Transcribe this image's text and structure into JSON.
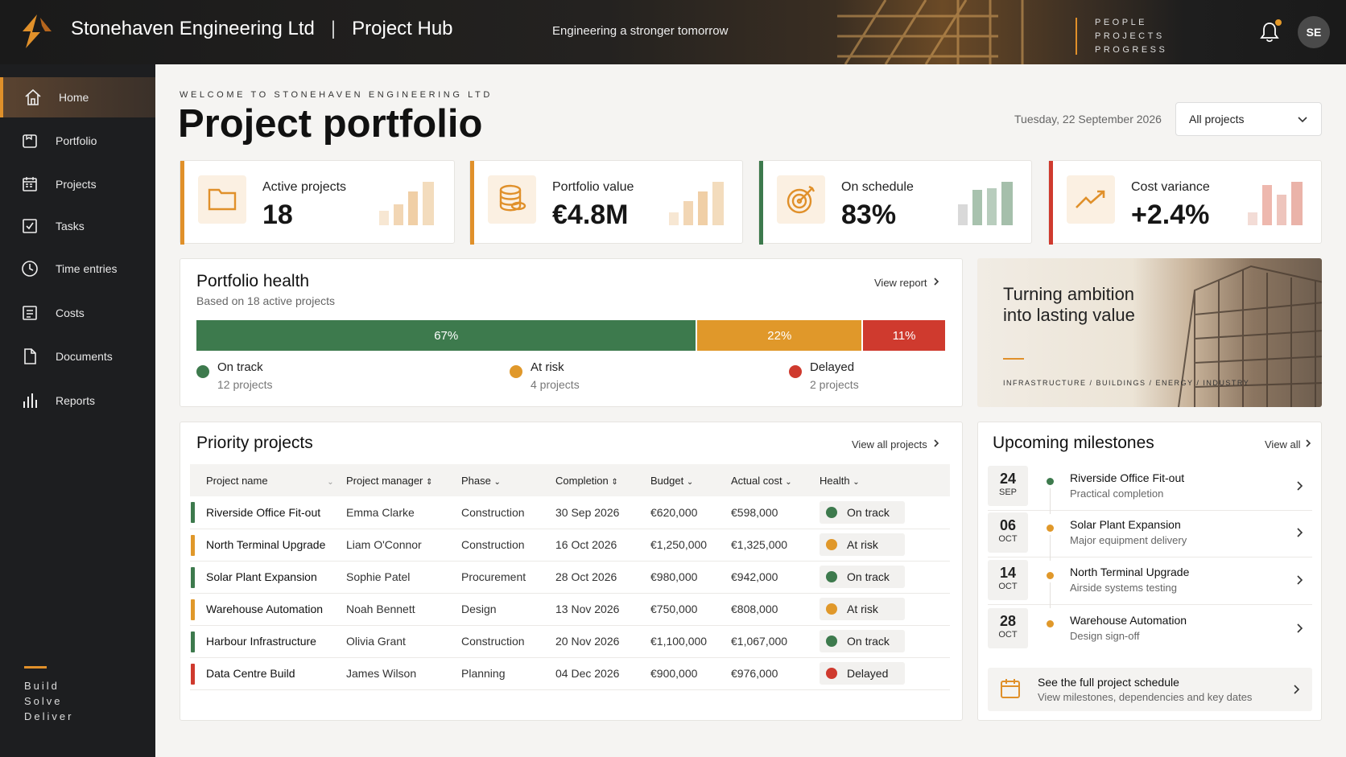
{
  "header": {
    "company": "Stonehaven Engineering Ltd",
    "app": "Project Hub",
    "tagline": "Engineering a stronger tomorrow",
    "motto": [
      "PEOPLE",
      "PROJECTS",
      "PROGRESS"
    ],
    "avatar_initials": "SE"
  },
  "sidebar": {
    "items": [
      {
        "label": "Home",
        "icon": "home-icon"
      },
      {
        "label": "Portfolio",
        "icon": "briefcase-icon"
      },
      {
        "label": "Projects",
        "icon": "calendar-icon"
      },
      {
        "label": "Tasks",
        "icon": "checkbox-icon"
      },
      {
        "label": "Time entries",
        "icon": "clock-icon"
      },
      {
        "label": "Costs",
        "icon": "receipt-icon"
      },
      {
        "label": "Documents",
        "icon": "document-icon"
      },
      {
        "label": "Reports",
        "icon": "bar-chart-icon"
      }
    ],
    "motto": [
      "Build",
      "Solve",
      "Deliver"
    ]
  },
  "page": {
    "welcome": "WELCOME TO STONEHAVEN ENGINEERING LTD",
    "title": "Project portfolio",
    "date": "Tuesday, 22 September 2026",
    "filter": "All projects"
  },
  "kpis": [
    {
      "label": "Active projects",
      "value": "18",
      "color": "#e0902a",
      "icon": "folder-icon"
    },
    {
      "label": "Portfolio value",
      "value": "€4.8M",
      "color": "#e0902a",
      "icon": "coins-icon"
    },
    {
      "label": "On schedule",
      "value": "83%",
      "color": "#3d7a4d",
      "icon": "target-icon"
    },
    {
      "label": "Cost variance",
      "value": "+2.4%",
      "color": "#cf3a2e",
      "icon": "trend-up-icon"
    }
  ],
  "health": {
    "title": "Portfolio health",
    "subtitle": "Based on 18 active projects",
    "link": "View report",
    "segments": [
      {
        "pct": "67%",
        "value": 67,
        "color": "#3d7a4d",
        "label": "On track",
        "sub": "12 projects"
      },
      {
        "pct": "22%",
        "value": 22,
        "color": "#e0982a",
        "label": "At risk",
        "sub": "4 projects"
      },
      {
        "pct": "11%",
        "value": 11,
        "color": "#cf3a2e",
        "label": "Delayed",
        "sub": "2 projects"
      }
    ]
  },
  "promo": {
    "title": "Turning ambition into lasting value",
    "tags": "INFRASTRUCTURE / BUILDINGS / ENERGY / INDUSTRY"
  },
  "priority": {
    "title": "Priority projects",
    "link": "View all projects",
    "columns": [
      "Project name",
      "Project manager",
      "Phase",
      "Completion",
      "Budget",
      "Actual cost",
      "Health"
    ],
    "rows": [
      {
        "name": "Riverside Office Fit-out",
        "manager": "Emma Clarke",
        "phase": "Construction",
        "completion": "30 Sep 2026",
        "budget": "€620,000",
        "actual": "€598,000",
        "health": "On track",
        "color": "#3d7a4d"
      },
      {
        "name": "North Terminal Upgrade",
        "manager": "Liam O'Connor",
        "phase": "Construction",
        "completion": "16 Oct 2026",
        "budget": "€1,250,000",
        "actual": "€1,325,000",
        "health": "At risk",
        "color": "#e0982a"
      },
      {
        "name": "Solar Plant Expansion",
        "manager": "Sophie Patel",
        "phase": "Procurement",
        "completion": "28 Oct 2026",
        "budget": "€980,000",
        "actual": "€942,000",
        "health": "On track",
        "color": "#3d7a4d"
      },
      {
        "name": "Warehouse Automation",
        "manager": "Noah Bennett",
        "phase": "Design",
        "completion": "13 Nov 2026",
        "budget": "€750,000",
        "actual": "€808,000",
        "health": "At risk",
        "color": "#e0982a"
      },
      {
        "name": "Harbour Infrastructure",
        "manager": "Olivia Grant",
        "phase": "Construction",
        "completion": "20 Nov 2026",
        "budget": "€1,100,000",
        "actual": "€1,067,000",
        "health": "On track",
        "color": "#3d7a4d"
      },
      {
        "name": "Data Centre Build",
        "manager": "James Wilson",
        "phase": "Planning",
        "completion": "04 Dec 2026",
        "budget": "€900,000",
        "actual": "€976,000",
        "health": "Delayed",
        "color": "#cf3a2e"
      }
    ]
  },
  "milestones": {
    "title": "Upcoming milestones",
    "link": "View all",
    "items": [
      {
        "day": "24",
        "month": "SEP",
        "title": "Riverside Office Fit-out",
        "sub": "Practical completion",
        "color": "#3d7a4d"
      },
      {
        "day": "06",
        "month": "OCT",
        "title": "Solar Plant Expansion",
        "sub": "Major equipment delivery",
        "color": "#e0982a"
      },
      {
        "day": "14",
        "month": "OCT",
        "title": "North Terminal Upgrade",
        "sub": "Airside systems testing",
        "color": "#e0982a"
      },
      {
        "day": "28",
        "month": "OCT",
        "title": "Warehouse Automation",
        "sub": "Design sign-off",
        "color": "#e0982a"
      }
    ],
    "schedule_title": "See the full project schedule",
    "schedule_sub": "View milestones, dependencies and key dates"
  }
}
